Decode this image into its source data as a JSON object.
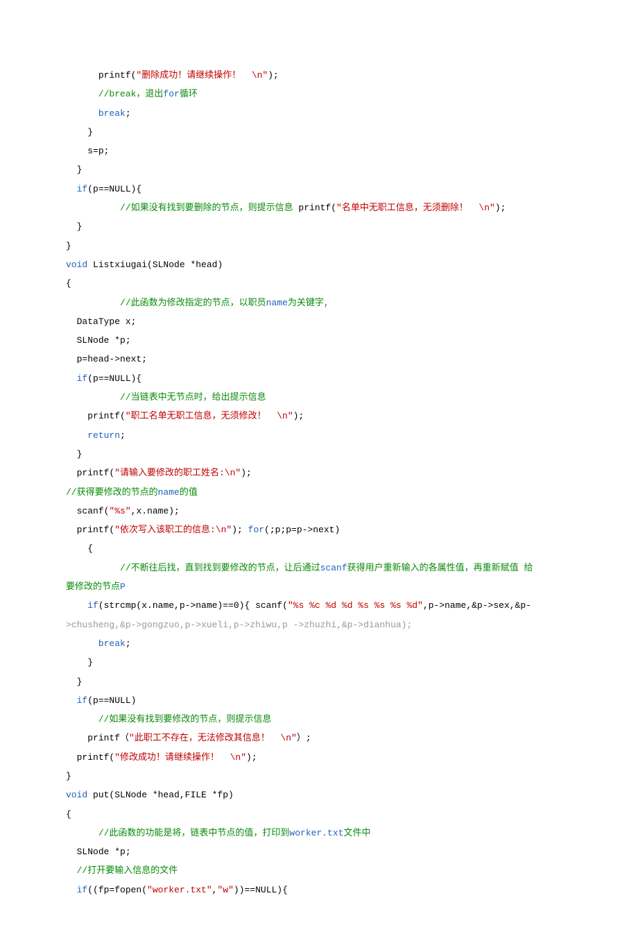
{
  "lines": [
    {
      "indent": 3,
      "segs": [
        {
          "t": "txt",
          "v": "printf("
        },
        {
          "t": "str",
          "v": "\"删除成功！请继续操作！  \\n\""
        },
        {
          "t": "txt",
          "v": ");"
        }
      ]
    },
    {
      "indent": 3,
      "segs": [
        {
          "t": "cmt",
          "v": "//break，退出"
        },
        {
          "t": "kw",
          "v": "for"
        },
        {
          "t": "cmt",
          "v": "循环"
        }
      ]
    },
    {
      "indent": 3,
      "segs": [
        {
          "t": "kw",
          "v": "break"
        },
        {
          "t": "txt",
          "v": ";"
        }
      ]
    },
    {
      "indent": 2,
      "segs": [
        {
          "t": "txt",
          "v": "}"
        }
      ]
    },
    {
      "indent": 2,
      "segs": [
        {
          "t": "txt",
          "v": "s=p;"
        }
      ]
    },
    {
      "indent": 1,
      "segs": [
        {
          "t": "txt",
          "v": "}"
        }
      ]
    },
    {
      "indent": 1,
      "segs": [
        {
          "t": "kw",
          "v": "if"
        },
        {
          "t": "txt",
          "v": "(p==NULL){"
        }
      ]
    },
    {
      "indent": 5,
      "segs": [
        {
          "t": "cmt",
          "v": "//如果没有找到要删除的节点，则提示信息 "
        },
        {
          "t": "txt",
          "v": "printf("
        },
        {
          "t": "str",
          "v": "\"名单中无职工信息，无须删除！  \\n\""
        },
        {
          "t": "txt",
          "v": ");"
        }
      ]
    },
    {
      "indent": 1,
      "segs": [
        {
          "t": "txt",
          "v": "}"
        }
      ]
    },
    {
      "indent": 0,
      "segs": [
        {
          "t": "txt",
          "v": "}"
        }
      ]
    },
    {
      "indent": 0,
      "segs": [
        {
          "t": "kw",
          "v": "void"
        },
        {
          "t": "txt",
          "v": " Listxiugai(SLNode *head)"
        }
      ]
    },
    {
      "indent": 0,
      "segs": [
        {
          "t": "txt",
          "v": "{"
        }
      ]
    },
    {
      "indent": 5,
      "segs": [
        {
          "t": "cmt",
          "v": "//此函数为修改指定的节点，以职员"
        },
        {
          "t": "kw",
          "v": "name"
        },
        {
          "t": "cmt",
          "v": "为关键字,"
        }
      ]
    },
    {
      "indent": 1,
      "segs": [
        {
          "t": "txt",
          "v": "DataType x;"
        }
      ]
    },
    {
      "indent": 1,
      "segs": [
        {
          "t": "txt",
          "v": "SLNode *p;"
        }
      ]
    },
    {
      "indent": 1,
      "segs": [
        {
          "t": "txt",
          "v": "p=head->next;"
        }
      ]
    },
    {
      "indent": 1,
      "segs": [
        {
          "t": "kw",
          "v": "if"
        },
        {
          "t": "txt",
          "v": "(p==NULL){"
        }
      ]
    },
    {
      "indent": 5,
      "segs": [
        {
          "t": "cmt",
          "v": "//当链表中无节点时，给出提示信息"
        }
      ]
    },
    {
      "indent": 2,
      "segs": [
        {
          "t": "txt",
          "v": "printf("
        },
        {
          "t": "str",
          "v": "\"职工名单无职工信息，无须修改！  \\n\""
        },
        {
          "t": "txt",
          "v": ");"
        }
      ]
    },
    {
      "indent": 2,
      "segs": [
        {
          "t": "kw",
          "v": "return"
        },
        {
          "t": "txt",
          "v": ";"
        }
      ]
    },
    {
      "indent": 1,
      "segs": [
        {
          "t": "txt",
          "v": "}"
        }
      ]
    },
    {
      "indent": 1,
      "segs": [
        {
          "t": "txt",
          "v": "printf("
        },
        {
          "t": "str",
          "v": "\"请输入要修改的职工姓名:\\n\""
        },
        {
          "t": "txt",
          "v": ");"
        }
      ]
    },
    {
      "indent": 0,
      "segs": [
        {
          "t": "cmt",
          "v": "//获得要修改的节点的"
        },
        {
          "t": "kw",
          "v": "name"
        },
        {
          "t": "cmt",
          "v": "的值"
        }
      ]
    },
    {
      "indent": 1,
      "segs": [
        {
          "t": "txt",
          "v": "scanf("
        },
        {
          "t": "str",
          "v": "\"%s\""
        },
        {
          "t": "txt",
          "v": ",x.name);"
        }
      ]
    },
    {
      "indent": 1,
      "segs": [
        {
          "t": "txt",
          "v": "printf("
        },
        {
          "t": "str",
          "v": "\"依次写入该职工的信息:\\n\""
        },
        {
          "t": "txt",
          "v": "); "
        },
        {
          "t": "kw",
          "v": "for"
        },
        {
          "t": "txt",
          "v": "(;p;p=p->next)"
        }
      ]
    },
    {
      "indent": 2,
      "segs": [
        {
          "t": "txt",
          "v": "{"
        }
      ]
    },
    {
      "indent": 5,
      "segs": [
        {
          "t": "cmt",
          "v": "//不断往后找，直到找到要修改的节点，让后通过"
        },
        {
          "t": "kw",
          "v": "scanf"
        },
        {
          "t": "cmt",
          "v": "获得用户重新输入的各属性值，再重新赋值 给"
        }
      ],
      "wrap": true
    },
    {
      "indent": 0,
      "segs": [
        {
          "t": "cmt",
          "v": "要修改的节点"
        },
        {
          "t": "kw",
          "v": "P"
        }
      ]
    },
    {
      "indent": 2,
      "segs": [
        {
          "t": "kw",
          "v": "if"
        },
        {
          "t": "txt",
          "v": "(strcmp(x.name,p->name)==0){ scanf("
        },
        {
          "t": "str",
          "v": "\"%s %c %d %d %s %s %s %d\""
        },
        {
          "t": "txt",
          "v": ",p->name,&p->sex,&p-"
        }
      ]
    },
    {
      "indent": 0,
      "segs": [
        {
          "t": "grey",
          "v": ">chusheng,&p->gongzuo,p->xueli,p->zhiwu,p ->zhuzhi,&p->dianhua);"
        }
      ]
    },
    {
      "indent": 3,
      "segs": [
        {
          "t": "kw",
          "v": "break"
        },
        {
          "t": "txt",
          "v": ";"
        }
      ]
    },
    {
      "indent": 2,
      "segs": [
        {
          "t": "txt",
          "v": "}"
        }
      ]
    },
    {
      "indent": 1,
      "segs": [
        {
          "t": "txt",
          "v": "}"
        }
      ]
    },
    {
      "indent": 1,
      "segs": [
        {
          "t": "kw",
          "v": "if"
        },
        {
          "t": "txt",
          "v": "(p==NULL)"
        }
      ]
    },
    {
      "indent": 3,
      "segs": [
        {
          "t": "cmt",
          "v": "//如果没有找到要修改的节点，则提示信息"
        }
      ]
    },
    {
      "indent": 2,
      "segs": [
        {
          "t": "txt",
          "v": "printf（"
        },
        {
          "t": "str",
          "v": "\"此职工不存在，无法修改其信息！  \\n\""
        },
        {
          "t": "txt",
          "v": "）;"
        }
      ]
    },
    {
      "indent": 1,
      "segs": [
        {
          "t": "txt",
          "v": "printf("
        },
        {
          "t": "str",
          "v": "\"修改成功！请继续操作！  \\n\""
        },
        {
          "t": "txt",
          "v": ");"
        }
      ]
    },
    {
      "indent": 0,
      "segs": [
        {
          "t": "txt",
          "v": "}"
        }
      ]
    },
    {
      "indent": 0,
      "segs": [
        {
          "t": "kw",
          "v": "void"
        },
        {
          "t": "txt",
          "v": " put(SLNode *head,FILE *fp)"
        }
      ]
    },
    {
      "indent": 0,
      "segs": [
        {
          "t": "txt",
          "v": "{"
        }
      ]
    },
    {
      "indent": 3,
      "segs": [
        {
          "t": "cmt",
          "v": "//此函数的功能是将，链表中节点的值，打印到"
        },
        {
          "t": "kw",
          "v": "worker.txt"
        },
        {
          "t": "cmt",
          "v": "文件中"
        }
      ]
    },
    {
      "indent": 1,
      "segs": [
        {
          "t": "txt",
          "v": "SLNode *p;"
        }
      ]
    },
    {
      "indent": 1,
      "segs": [
        {
          "t": "cmt",
          "v": "//打开要输入信息的文件"
        }
      ]
    },
    {
      "indent": 1,
      "segs": [
        {
          "t": "kw",
          "v": "if"
        },
        {
          "t": "txt",
          "v": "((fp=fopen("
        },
        {
          "t": "str",
          "v": "\"worker.txt\""
        },
        {
          "t": "txt",
          "v": ","
        },
        {
          "t": "str",
          "v": "\"w\""
        },
        {
          "t": "txt",
          "v": "))==NULL){"
        }
      ]
    }
  ]
}
